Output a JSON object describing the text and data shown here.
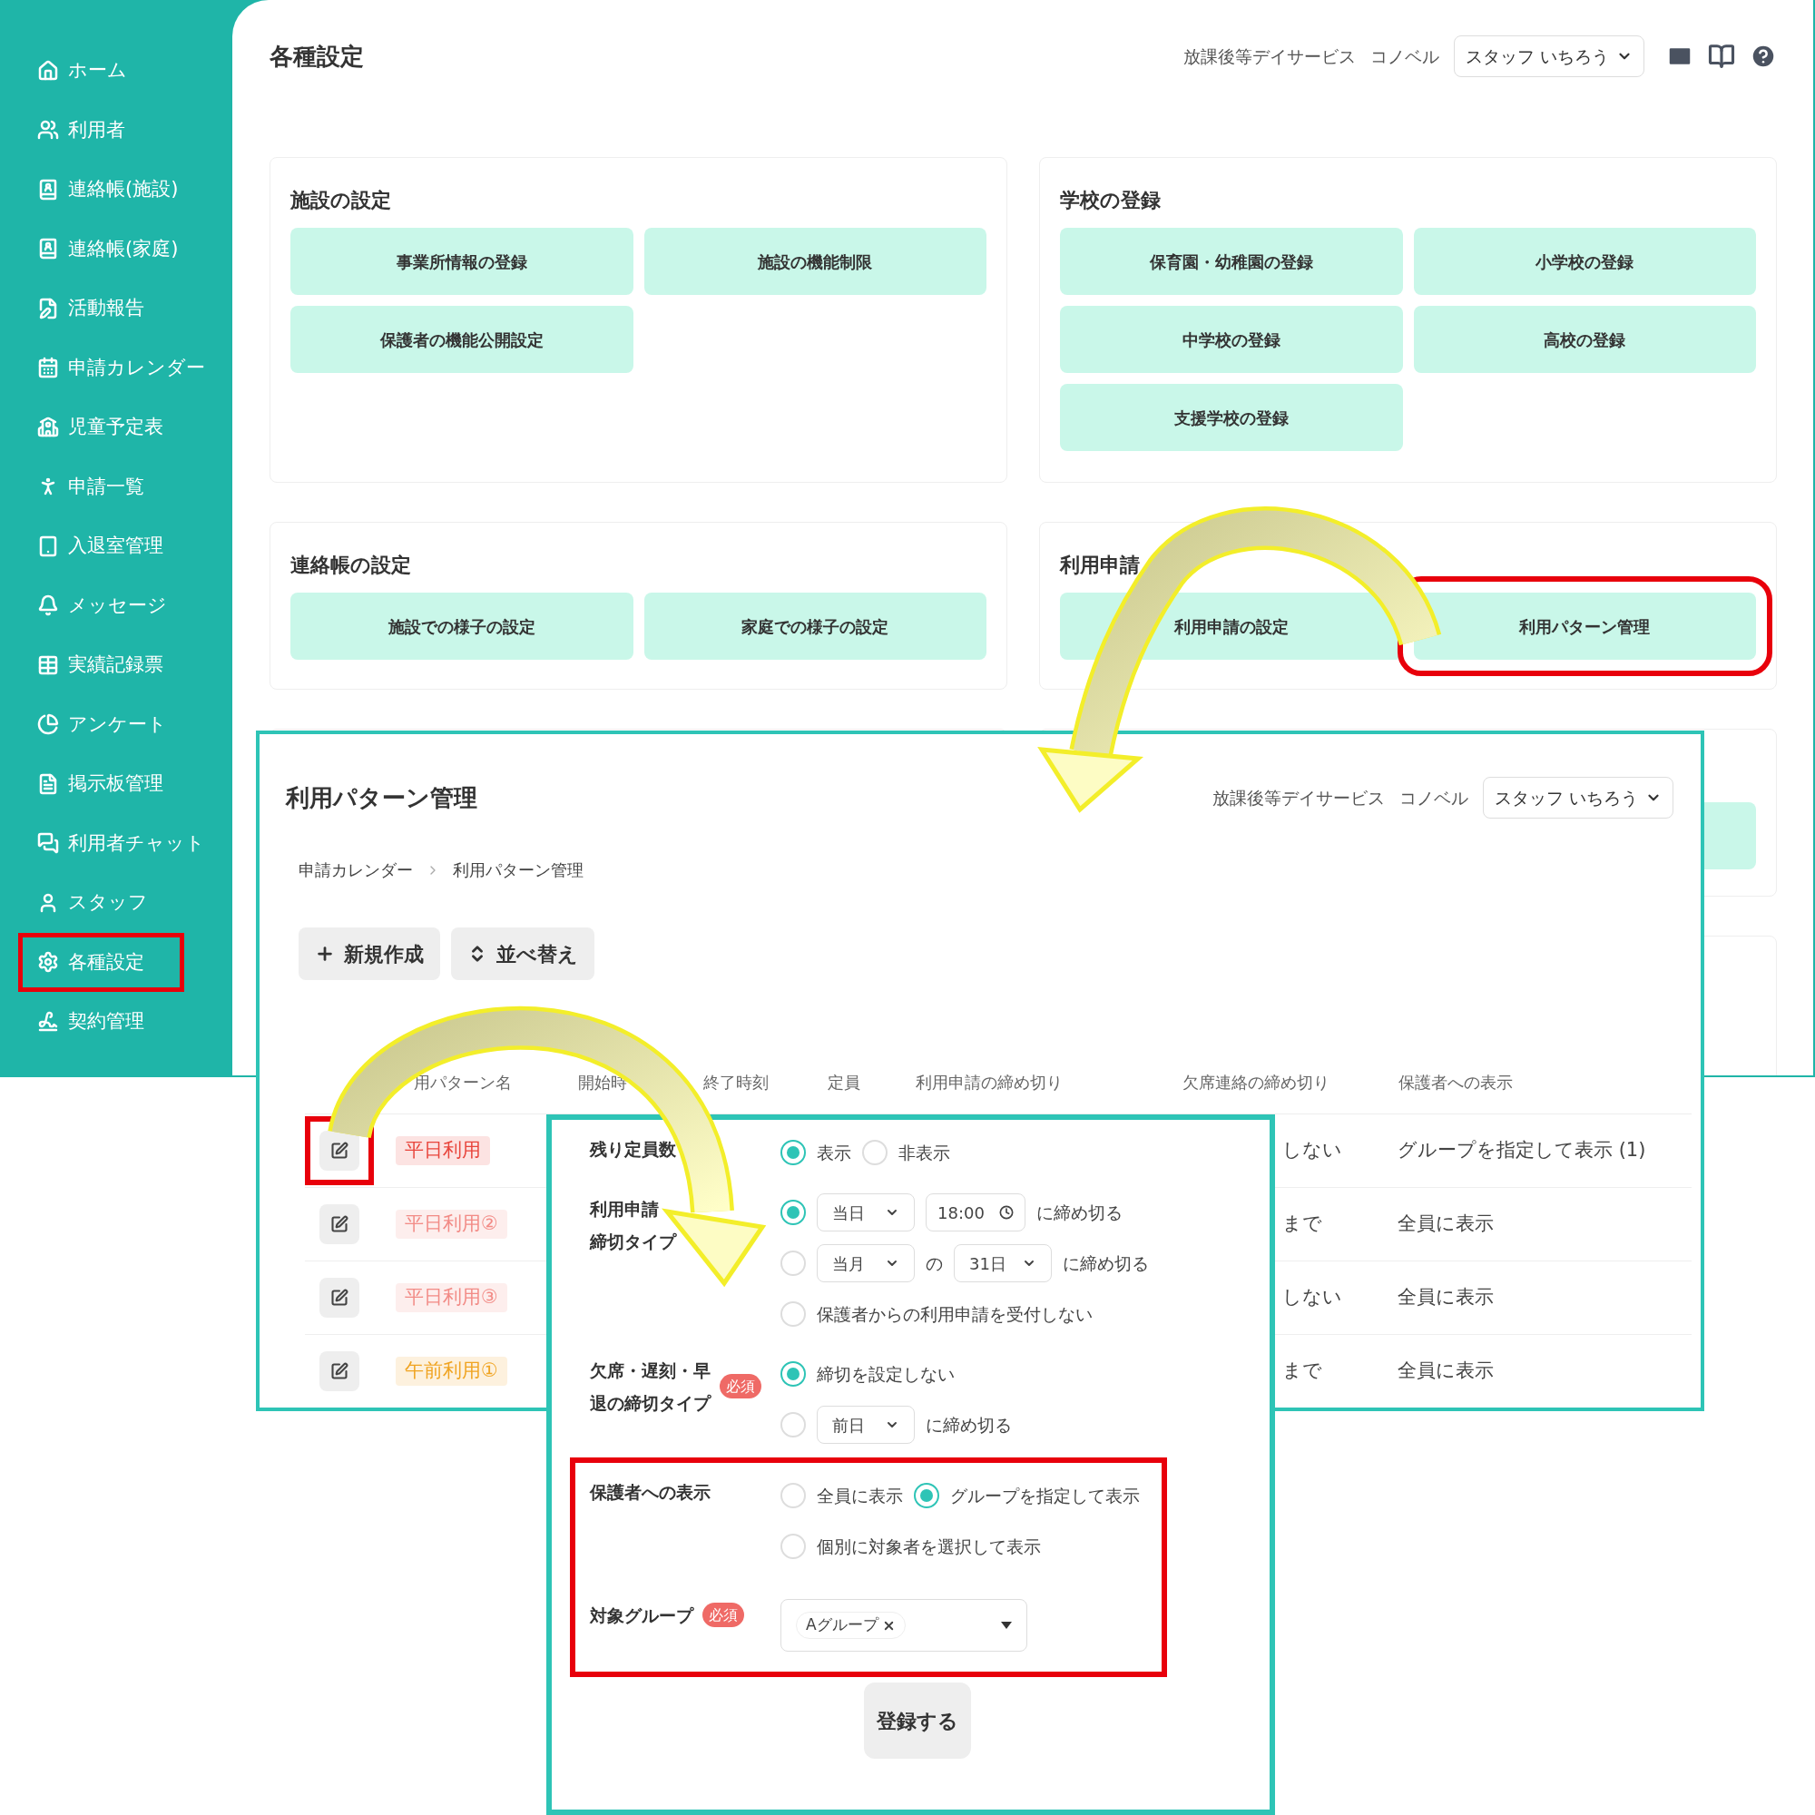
{
  "sidebar": {
    "items": [
      {
        "label": "ホーム",
        "highlighted": false
      },
      {
        "label": "利用者",
        "highlighted": false
      },
      {
        "label": "連絡帳(施設)",
        "highlighted": false
      },
      {
        "label": "連絡帳(家庭)",
        "highlighted": false
      },
      {
        "label": "活動報告",
        "highlighted": false
      },
      {
        "label": "申請カレンダー",
        "highlighted": false
      },
      {
        "label": "児童予定表",
        "highlighted": false
      },
      {
        "label": "申請一覧",
        "highlighted": false
      },
      {
        "label": "入退室管理",
        "highlighted": false
      },
      {
        "label": "メッセージ",
        "highlighted": false
      },
      {
        "label": "実績記録票",
        "highlighted": false
      },
      {
        "label": "アンケート",
        "highlighted": false
      },
      {
        "label": "掲示板管理",
        "highlighted": false
      },
      {
        "label": "利用者チャット",
        "highlighted": false
      },
      {
        "label": "スタッフ",
        "highlighted": false
      },
      {
        "label": "各種設定",
        "highlighted": true
      },
      {
        "label": "契約管理",
        "highlighted": false
      }
    ]
  },
  "header": {
    "title": "各種設定",
    "facility_type": "放課後等デイサービス",
    "facility_name": "コノベル",
    "staff_select": "スタッフ いちろう"
  },
  "sections": [
    {
      "title": "施設の設定",
      "buttons": [
        {
          "label": "事業所情報の登録",
          "highlighted": false
        },
        {
          "label": "施設の機能制限",
          "highlighted": false
        },
        {
          "label": "保護者の機能公開設定",
          "highlighted": false
        }
      ]
    },
    {
      "title": "学校の登録",
      "buttons": [
        {
          "label": "保育園・幼稚園の登録",
          "highlighted": false
        },
        {
          "label": "小学校の登録",
          "highlighted": false
        },
        {
          "label": "中学校の登録",
          "highlighted": false
        },
        {
          "label": "高校の登録",
          "highlighted": false
        },
        {
          "label": "支援学校の登録",
          "highlighted": false
        }
      ]
    },
    {
      "title": "連絡帳の設定",
      "buttons": [
        {
          "label": "施設での様子の設定",
          "highlighted": false
        },
        {
          "label": "家庭での様子の設定",
          "highlighted": false
        }
      ]
    },
    {
      "title": "利用申請",
      "buttons": [
        {
          "label": "利用申請の設定",
          "highlighted": false
        },
        {
          "label": "利用パターン管理",
          "highlighted": true
        }
      ]
    }
  ],
  "pattern_page": {
    "title": "利用パターン管理",
    "facility_type": "放課後等デイサービス",
    "facility_name": "コノベル",
    "staff_select": "スタッフ いちろう",
    "breadcrumb": [
      "申請カレンダー",
      "利用パターン管理"
    ],
    "actions": [
      {
        "kind": "create",
        "label": "新規作成"
      },
      {
        "kind": "sort",
        "label": "並べ替え"
      }
    ],
    "table": {
      "columns": [
        "用パターン名",
        "開始時",
        "終了時刻",
        "定員",
        "利用申請の締め切り",
        "欠席連絡の締め切り",
        "保護者への表示"
      ],
      "rows": [
        {
          "edit_highlighted": true,
          "name": "平日利用",
          "color": "#e8453c",
          "absence_deadline": "しない",
          "display": "グループを指定して表示 (1)"
        },
        {
          "edit_highlighted": false,
          "name": "平日利用②",
          "color": "#f28b86",
          "absence_deadline": "まで",
          "display": "全員に表示"
        },
        {
          "edit_highlighted": false,
          "name": "平日利用③",
          "color": "#f28b86",
          "absence_deadline": "しない",
          "display": "全員に表示"
        },
        {
          "edit_highlighted": false,
          "name": "午前利用①",
          "color": "#f0a422",
          "absence_deadline": "まで",
          "display": "全員に表示"
        }
      ]
    }
  },
  "form": {
    "fields": [
      {
        "label": [
          "残り定員数"
        ],
        "rows": [
          {
            "items": [
              {
                "kind": "radio",
                "selected": true,
                "label": "表示"
              },
              {
                "kind": "radio",
                "selected": false,
                "label": "非表示"
              }
            ]
          }
        ]
      },
      {
        "label": [
          "利用申請",
          "締切タイプ"
        ],
        "rows": [
          {
            "items": [
              {
                "kind": "radio",
                "selected": true
              },
              {
                "kind": "select",
                "value": "当日"
              },
              {
                "kind": "time",
                "value": "18:00"
              },
              {
                "kind": "text",
                "text": "に締め切る"
              }
            ]
          },
          {
            "items": [
              {
                "kind": "radio",
                "selected": false
              },
              {
                "kind": "select",
                "value": "当月"
              },
              {
                "kind": "text",
                "text": "の"
              },
              {
                "kind": "select",
                "value": "31日"
              },
              {
                "kind": "text",
                "text": "に締め切る"
              }
            ]
          },
          {
            "items": [
              {
                "kind": "radio",
                "selected": false,
                "label": "保護者からの利用申請を受付しない"
              }
            ]
          }
        ]
      },
      {
        "label": [
          "欠席・遅刻・早",
          "退の締切タイプ"
        ],
        "badge": "必須",
        "rows": [
          {
            "items": [
              {
                "kind": "radio",
                "selected": true,
                "label": "締切を設定しない"
              }
            ]
          },
          {
            "items": [
              {
                "kind": "radio",
                "selected": false
              },
              {
                "kind": "select",
                "value": "前日"
              },
              {
                "kind": "text",
                "text": "に締め切る"
              }
            ]
          }
        ]
      }
    ],
    "highlighted_fields": [
      {
        "label": [
          "保護者への表示"
        ],
        "rows": [
          {
            "items": [
              {
                "kind": "radio",
                "selected": false,
                "label": "全員に表示"
              },
              {
                "kind": "radio",
                "selected": true,
                "label": "グループを指定して表示"
              }
            ]
          },
          {
            "items": [
              {
                "kind": "radio",
                "selected": false,
                "label": "個別に対象者を選択して表示"
              }
            ]
          }
        ]
      },
      {
        "label": [
          "対象グループ"
        ],
        "badge": "必須",
        "rows": [
          {
            "items": [
              {
                "kind": "multiselect",
                "chips": [
                  "Aグループ"
                ]
              }
            ]
          }
        ]
      }
    ],
    "submit": "登録する"
  }
}
